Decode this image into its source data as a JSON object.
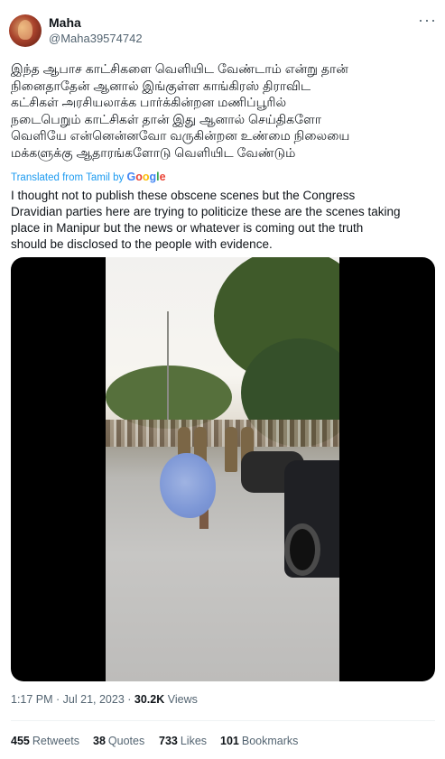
{
  "author": {
    "name": "Maha",
    "handle": "@Maha39574742"
  },
  "more_menu_label": "···",
  "tweet": {
    "tamil_lines": [
      "இந்த ஆபாச காட்சிகளை வெளியிட வேண்டாம் என்று தான்",
      "நினைதாதேன் ஆனால் இங்குள்ள காங்கிரஸ் திராவிட",
      "கட்சிகள் அரசியலாக்க பார்க்கின்றன மணிப்பூரில்",
      "நடைபெறும் காட்சிகள் தான் இது ஆனால் செய்திகளோ",
      "வெளியே என்னென்னவோ வருகின்றன உண்மை நிலையை",
      "மக்களுக்கு ஆதாரங்களோடு வெளியிட வேண்டும்"
    ],
    "translated_label": "Translated from Tamil by",
    "google_letters": [
      "G",
      "o",
      "o",
      "g",
      "l",
      "e"
    ],
    "english_lines": [
      "I thought not to publish these obscene scenes but the Congress",
      "Dravidian parties here are trying to politicize these are the scenes taking",
      "place in Manipur but the news or whatever is coming out the truth",
      "should be disclosed to the people with evidence."
    ]
  },
  "meta": {
    "time": "1:17 PM",
    "separator": " · ",
    "date": "Jul 21, 2023",
    "views_count": "30.2K",
    "views_label": "Views"
  },
  "stats": {
    "retweets_count": "455",
    "retweets_label": "Retweets",
    "quotes_count": "38",
    "quotes_label": "Quotes",
    "likes_count": "733",
    "likes_label": "Likes",
    "bookmarks_count": "101",
    "bookmarks_label": "Bookmarks"
  }
}
